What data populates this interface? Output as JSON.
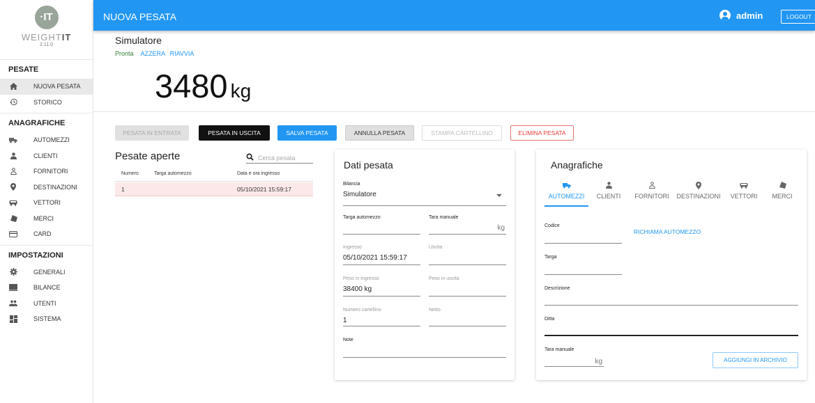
{
  "logo": {
    "mark": "·IT",
    "text_a": "WEIGHT",
    "text_b": "IT",
    "version": "2.11.0"
  },
  "sidebar": {
    "sections": [
      {
        "title": "PESATE",
        "items": [
          {
            "label": "NUOVA PESATA",
            "icon": "home-icon"
          },
          {
            "label": "STORICO",
            "icon": "history-icon"
          }
        ]
      },
      {
        "title": "ANAGRAFICHE",
        "items": [
          {
            "label": "AUTOMEZZI",
            "icon": "truck-icon"
          },
          {
            "label": "CLIENTI",
            "icon": "person-icon"
          },
          {
            "label": "FORNITORI",
            "icon": "person-outline-icon"
          },
          {
            "label": "DESTINAZIONI",
            "icon": "map-pin-icon"
          },
          {
            "label": "VETTORI",
            "icon": "bus-icon"
          },
          {
            "label": "MERCI",
            "icon": "goods-icon"
          },
          {
            "label": "CARD",
            "icon": "credit-card-icon"
          }
        ]
      },
      {
        "title": "IMPOSTAZIONI",
        "items": [
          {
            "label": "GENERALI",
            "icon": "gear-icon"
          },
          {
            "label": "BILANCE",
            "icon": "scale-icon"
          },
          {
            "label": "UTENTI",
            "icon": "users-icon"
          },
          {
            "label": "SISTEMA",
            "icon": "dashboard-icon"
          }
        ]
      }
    ]
  },
  "header": {
    "title": "NUOVA PESATA",
    "user": "admin",
    "logout": "LOGOUT"
  },
  "scale": {
    "name": "Simulatore",
    "status": "Pronta",
    "reset": "AZZERA",
    "restart": "RIAVVIA",
    "weight": "3480",
    "unit": "kg"
  },
  "actions": {
    "in": "PESATA IN ENTRATA",
    "out": "PESATA IN USCITA",
    "save": "SALVA PESATA",
    "cancel": "ANNULLA PESATA",
    "print": "STAMPA CARTELLINO",
    "delete": "ELIMINA PESATA"
  },
  "open": {
    "title": "Pesate aperte",
    "search_placeholder": "Cerca pesata",
    "columns": [
      "Numero",
      "Targa automezzo",
      "Data e ora ingresso"
    ],
    "rows": [
      {
        "numero": "1",
        "targa": "",
        "data": "05/10/2021 15:59:17"
      }
    ]
  },
  "dati": {
    "title": "Dati pesata",
    "bilancia_label": "Bilancia",
    "bilancia_value": "Simulatore",
    "targa_label": "Targa automezzo",
    "targa_value": "",
    "tara_label": "Tara manuale",
    "tara_unit": "kg",
    "ingresso_label": "Ingresso",
    "ingresso_value": "05/10/2021 15:59:17",
    "uscita_label": "Uscita",
    "uscita_value": "",
    "peso_in_label": "Peso in ingresso",
    "peso_in_value": "38400 kg",
    "peso_out_label": "Peso in uscita",
    "peso_out_value": "",
    "cartellino_label": "Numero cartellino",
    "cartellino_value": "1",
    "netto_label": "Netto",
    "netto_value": "",
    "note_label": "Note",
    "note_value": ""
  },
  "anag": {
    "title": "Anagrafiche",
    "tabs": [
      {
        "label": "AUTOMEZZI",
        "icon": "truck-icon"
      },
      {
        "label": "CLIENTI",
        "icon": "person-icon"
      },
      {
        "label": "FORNITORI",
        "icon": "person-outline-icon"
      },
      {
        "label": "DESTINAZIONI",
        "icon": "map-pin-icon"
      },
      {
        "label": "VETTORI",
        "icon": "bus-icon"
      },
      {
        "label": "MERCI",
        "icon": "goods-icon"
      }
    ],
    "codice_label": "Codice",
    "recall": "RICHIAMA AUTOMEZZO",
    "targa_label": "Targa",
    "descrizione_label": "Descrizione",
    "ditta_label": "Ditta",
    "tara_label": "Tara manuale",
    "tara_unit": "kg",
    "add": "AGGIUNGI IN ARCHIVIO"
  },
  "colors": {
    "primary": "#2196f3",
    "danger": "#e53935",
    "ready": "#2e7d32",
    "row_highlight": "#fce8e8"
  }
}
